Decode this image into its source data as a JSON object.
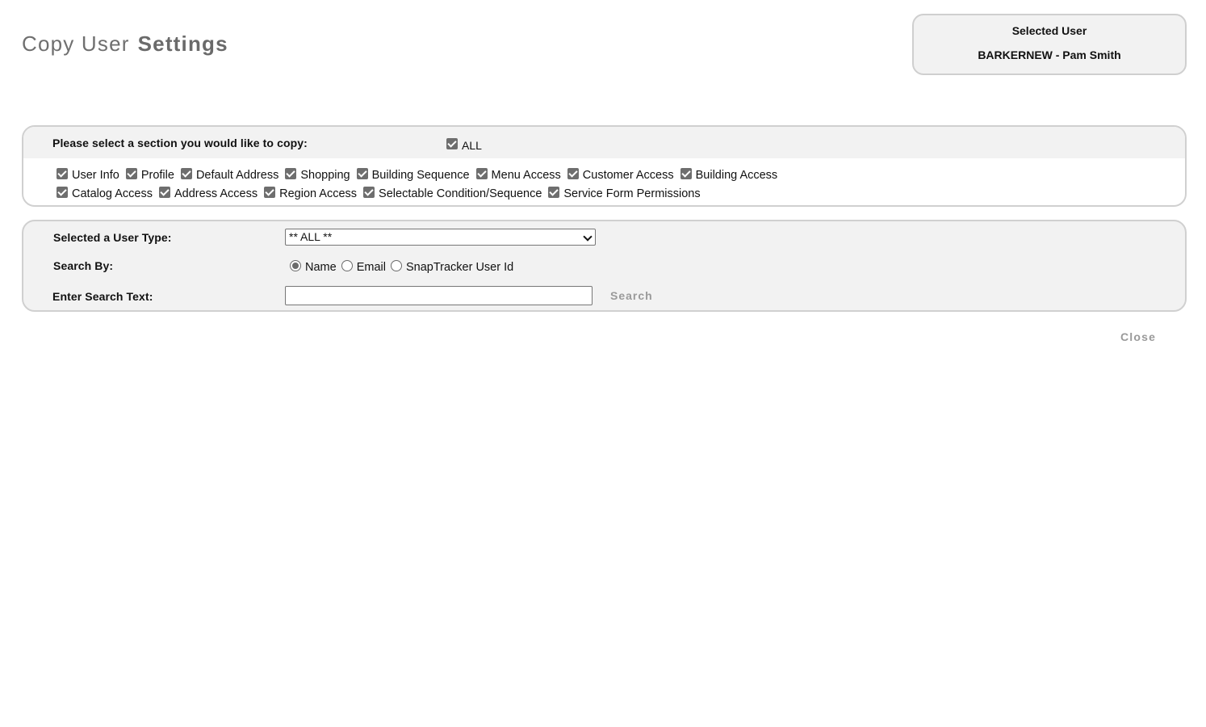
{
  "header": {
    "title_part1": "Copy User",
    "title_part2": "Settings"
  },
  "selected_user": {
    "label": "Selected User",
    "value": "BARKERNEW - Pam Smith"
  },
  "sections": {
    "prompt": "Please select a section you would like to copy:",
    "all_label": "ALL",
    "all_checked": true,
    "row1": [
      {
        "label": "User Info",
        "checked": true
      },
      {
        "label": "Profile",
        "checked": true
      },
      {
        "label": "Default Address",
        "checked": true
      },
      {
        "label": "Shopping",
        "checked": true
      },
      {
        "label": "Building Sequence",
        "checked": true
      },
      {
        "label": "Menu Access",
        "checked": true
      },
      {
        "label": "Customer Access",
        "checked": true
      },
      {
        "label": "Building Access",
        "checked": true
      }
    ],
    "row2": [
      {
        "label": "Catalog Access",
        "checked": true
      },
      {
        "label": "Address Access",
        "checked": true
      },
      {
        "label": "Region Access",
        "checked": true
      },
      {
        "label": "Selectable Condition/Sequence",
        "checked": true
      },
      {
        "label": "Service Form Permissions",
        "checked": true
      }
    ]
  },
  "search_form": {
    "user_type_label": "Selected a User Type:",
    "user_type_value": "** ALL **",
    "search_by_label": "Search By:",
    "search_by_options": [
      {
        "label": "Name",
        "selected": true
      },
      {
        "label": "Email",
        "selected": false
      },
      {
        "label": "SnapTracker User Id",
        "selected": false
      }
    ],
    "search_text_label": "Enter Search Text:",
    "search_text_value": "",
    "search_button": "Search"
  },
  "footer": {
    "close_button": "Close"
  },
  "colors": {
    "panel_bg": "#f2f2f2",
    "panel_border": "#d0d0d0",
    "muted_text": "#9a9a9a",
    "checkbox": "#6e6e6e"
  }
}
